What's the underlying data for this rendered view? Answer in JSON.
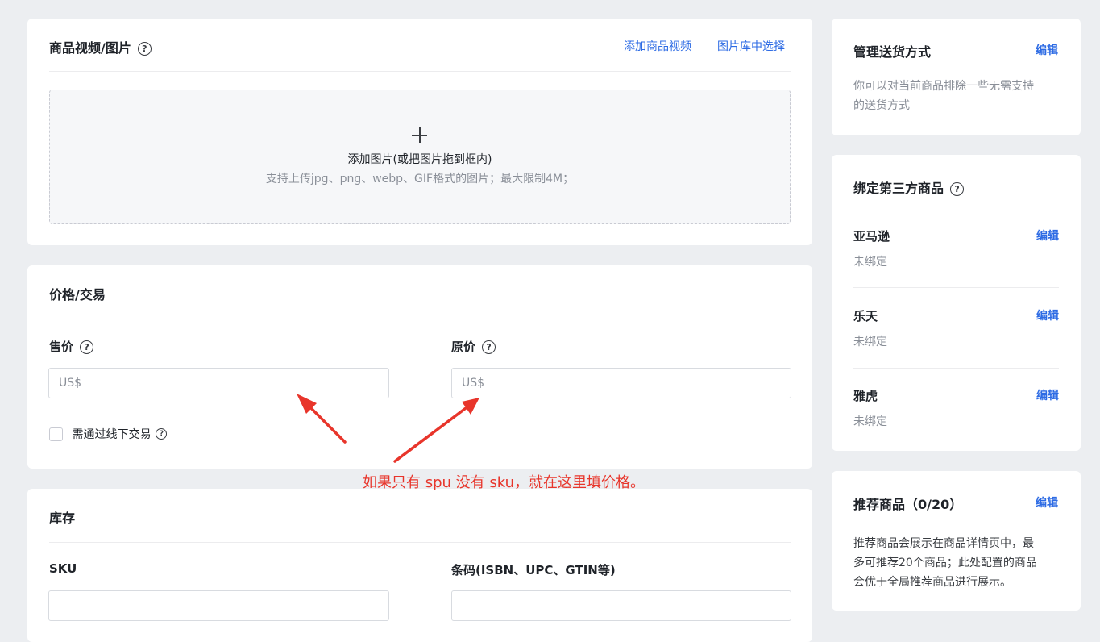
{
  "media": {
    "title": "商品视频/图片",
    "add_video": "添加商品视频",
    "choose_from_library": "图片库中选择",
    "upload_icon": "plus-icon",
    "upload_title": "添加图片(或把图片拖到框内)",
    "upload_hint": "支持上传jpg、png、webp、GIF格式的图片；最大限制4M；"
  },
  "pricing": {
    "title": "价格/交易",
    "sale_price_label": "售价",
    "sale_price_placeholder": "US$",
    "original_price_label": "原价",
    "original_price_placeholder": "US$",
    "offline_checkbox_label": "需通过线下交易"
  },
  "annotation": {
    "text": "如果只有 spu 没有 sku，就在这里填价格。",
    "color": "#e8352b"
  },
  "inventory": {
    "title": "库存",
    "sku_label": "SKU",
    "sku_value": "",
    "barcode_label": "条码(ISBN、UPC、GTIN等)",
    "barcode_value": ""
  },
  "shipping": {
    "title": "管理送货方式",
    "edit": "编辑",
    "description_line1": "你可以对当前商品排除一些无需支持",
    "description_line2": "的送货方式"
  },
  "third_party": {
    "title": "绑定第三方商品",
    "items": [
      {
        "name": "亚马逊",
        "status": "未绑定",
        "edit": "编辑"
      },
      {
        "name": "乐天",
        "status": "未绑定",
        "edit": "编辑"
      },
      {
        "name": "雅虎",
        "status": "未绑定",
        "edit": "编辑"
      }
    ]
  },
  "recommended": {
    "title": "推荐商品（0/20）",
    "edit": "编辑",
    "description_line1": "推荐商品会展示在商品详情页中，最",
    "description_line2": "多可推荐20个商品；此处配置的商品",
    "description_line3": "会优于全局推荐商品进行展示。"
  },
  "colors": {
    "link": "#2d6be4",
    "page_background": "#eceef1"
  }
}
